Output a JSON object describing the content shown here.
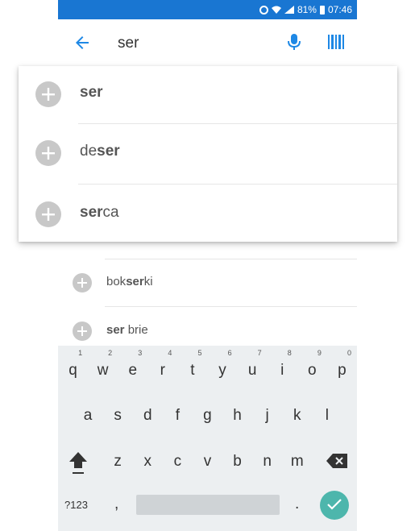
{
  "status": {
    "battery": "81%",
    "time": "07:46",
    "icons": [
      "alarm-icon",
      "wifi-icon",
      "signal-icon",
      "battery-icon"
    ]
  },
  "search": {
    "value": "ser"
  },
  "suggestions": [
    {
      "pre": "",
      "match": "ser",
      "post": ""
    },
    {
      "pre": "de",
      "match": "ser",
      "post": ""
    },
    {
      "pre": "",
      "match": "ser",
      "post": "ca"
    }
  ],
  "list": [
    {
      "pre": "bok",
      "match": "ser",
      "post": "ki"
    },
    {
      "pre": "",
      "match": "ser",
      "post": " brie"
    }
  ],
  "keyboard": {
    "row1": [
      {
        "ch": "q",
        "hint": "1"
      },
      {
        "ch": "w",
        "hint": "2"
      },
      {
        "ch": "e",
        "hint": "3"
      },
      {
        "ch": "r",
        "hint": "4"
      },
      {
        "ch": "t",
        "hint": "5"
      },
      {
        "ch": "y",
        "hint": "6"
      },
      {
        "ch": "u",
        "hint": "7"
      },
      {
        "ch": "i",
        "hint": "8"
      },
      {
        "ch": "o",
        "hint": "9"
      },
      {
        "ch": "p",
        "hint": "0"
      }
    ],
    "row2": [
      "a",
      "s",
      "d",
      "f",
      "g",
      "h",
      "j",
      "k",
      "l"
    ],
    "row3": [
      "z",
      "x",
      "c",
      "v",
      "b",
      "n",
      "m"
    ],
    "sym": "?123",
    "comma": ",",
    "period": "."
  },
  "colors": {
    "status_bar": "#1976d2",
    "accent_blue": "#1e88e5",
    "icon_gray": "#c8c8c8",
    "enter_key": "#4db6ac",
    "keyboard_bg": "#eceff1"
  }
}
